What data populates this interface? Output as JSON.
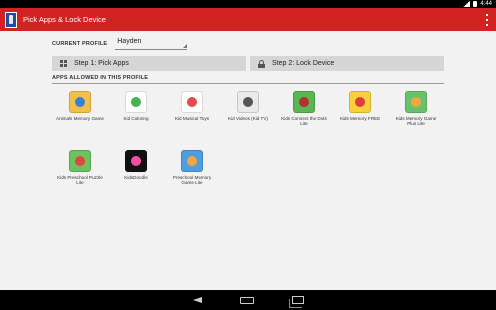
{
  "status_bar": {
    "time": "4:44"
  },
  "app_bar": {
    "title": "Pick Apps & Lock Device"
  },
  "profile": {
    "label": "CURRENT PROFILE",
    "selected": "Hayden"
  },
  "steps": [
    {
      "label": "Step 1: Pick Apps",
      "icon": "grid-icon"
    },
    {
      "label": "Step 2: Lock Device",
      "icon": "lock-icon"
    }
  ],
  "apps_section": {
    "label": "APPS ALLOWED IN THIS PROFILE"
  },
  "apps": [
    {
      "label": "Animals Memory Game",
      "icon": "animals-memory-icon",
      "bg": "#f2c14a",
      "accent": "#3b7fd6"
    },
    {
      "label": "Kid Coloring",
      "icon": "kid-coloring-icon",
      "bg": "#ffffff",
      "accent": "#4caf50"
    },
    {
      "label": "Kid Musical Toys",
      "icon": "kid-musical-toys-icon",
      "bg": "#ffffff",
      "accent": "#e64a4a"
    },
    {
      "label": "Kid Videos (Kid TV)",
      "icon": "kid-tv-icon",
      "bg": "#eaeaea",
      "accent": "#555555"
    },
    {
      "label": "Kids Connect the Dots Lite",
      "icon": "connect-dots-icon",
      "bg": "#5ab552",
      "accent": "#b23030"
    },
    {
      "label": "Kids Memory FREE",
      "icon": "kids-memory-free-icon",
      "bg": "#f7d03c",
      "accent": "#e23b3b"
    },
    {
      "label": "Kids Memory Game Plus Lite",
      "icon": "memory-plus-icon",
      "bg": "#69c26b",
      "accent": "#f2a93b"
    },
    {
      "label": "Kids Preschool Puzzle Lite",
      "icon": "preschool-puzzle-icon",
      "bg": "#6cc25f",
      "accent": "#e0473b"
    },
    {
      "label": "KidsDoodle",
      "icon": "kidsdoodle-icon",
      "bg": "#111111",
      "accent": "#ff4fa3"
    },
    {
      "label": "Preschool Memory Game Lite",
      "icon": "preschool-memory-icon",
      "bg": "#4f9de0",
      "accent": "#f2a93b"
    }
  ]
}
